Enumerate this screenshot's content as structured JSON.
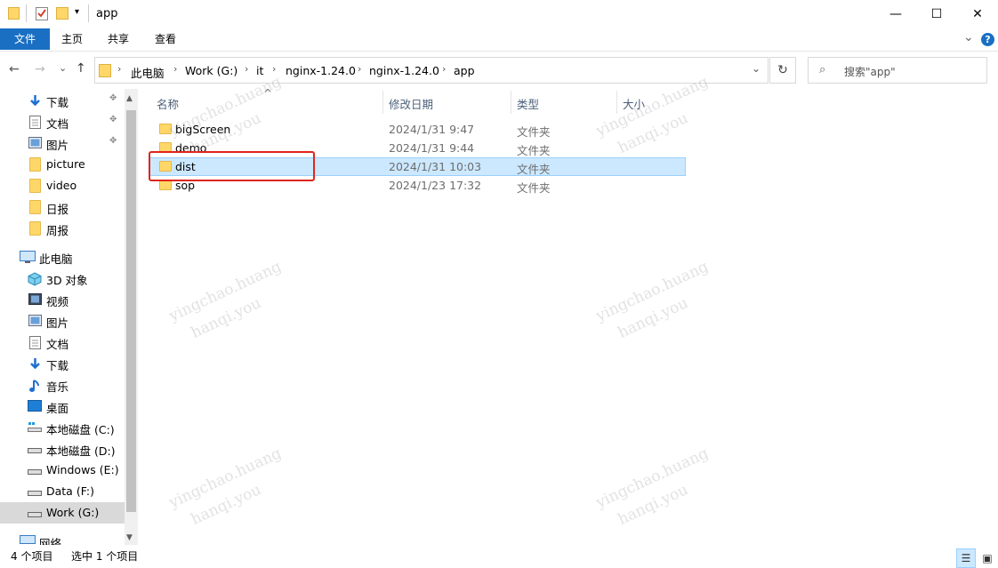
{
  "window": {
    "title": "app",
    "minimize": "—",
    "maximize": "☐",
    "close": "✕"
  },
  "ribbon": {
    "tabs": [
      "文件",
      "主页",
      "共享",
      "查看"
    ],
    "expand": "⌄",
    "help": "?"
  },
  "nav": {
    "back": "←",
    "forward": "→",
    "recent": "⌄",
    "up": "↑",
    "breadcrumbs": [
      "此电脑",
      "Work (G:)",
      "it",
      "nginx-1.24.0",
      "nginx-1.24.0",
      "app"
    ],
    "separator": "›",
    "dropdown": "⌄",
    "refresh": "↻",
    "search_placeholder": "搜索\"app\""
  },
  "sidebar": {
    "quick_access": [
      {
        "label": "下载",
        "icon": "download-icon",
        "pinned": true
      },
      {
        "label": "文档",
        "icon": "document-icon",
        "pinned": true
      },
      {
        "label": "图片",
        "icon": "picture-icon",
        "pinned": true
      },
      {
        "label": "picture",
        "icon": "folder-icon",
        "pinned": false
      },
      {
        "label": "video",
        "icon": "folder-icon",
        "pinned": false
      },
      {
        "label": "日报",
        "icon": "folder-icon",
        "pinned": false
      },
      {
        "label": "周报",
        "icon": "folder-icon",
        "pinned": false
      }
    ],
    "this_pc": {
      "label": "此电脑",
      "icon": "computer-icon"
    },
    "pc_items": [
      {
        "label": "3D 对象",
        "icon": "3d-objects-icon"
      },
      {
        "label": "视频",
        "icon": "video-icon"
      },
      {
        "label": "图片",
        "icon": "picture-icon"
      },
      {
        "label": "文档",
        "icon": "document-icon"
      },
      {
        "label": "下载",
        "icon": "download-icon"
      },
      {
        "label": "音乐",
        "icon": "music-icon"
      },
      {
        "label": "桌面",
        "icon": "desktop-icon"
      },
      {
        "label": "本地磁盘 (C:)",
        "icon": "drive-icon"
      },
      {
        "label": "本地磁盘 (D:)",
        "icon": "drive-icon"
      },
      {
        "label": "Windows (E:)",
        "icon": "drive-icon"
      },
      {
        "label": "Data (F:)",
        "icon": "drive-icon"
      },
      {
        "label": "Work (G:)",
        "icon": "drive-icon",
        "selected": true
      }
    ],
    "network": {
      "label": "网络",
      "icon": "network-icon"
    },
    "pin_glyph": "📌"
  },
  "columns": {
    "sort_indicator": "^",
    "name": "名称",
    "date": "修改日期",
    "type": "类型",
    "size": "大小"
  },
  "files": [
    {
      "name": "bigScreen",
      "date": "2024/1/31 9:47",
      "type": "文件夹",
      "selected": false
    },
    {
      "name": "demo",
      "date": "2024/1/31 9:44",
      "type": "文件夹",
      "selected": false
    },
    {
      "name": "dist",
      "date": "2024/1/31 10:03",
      "type": "文件夹",
      "selected": true
    },
    {
      "name": "sop",
      "date": "2024/1/23 17:32",
      "type": "文件夹",
      "selected": false
    }
  ],
  "watermark": {
    "line1": "yingchao.huang",
    "line2": "hanqi.you"
  },
  "status": {
    "item_count": "4 个项目",
    "selected": "选中 1 个项目"
  },
  "colors": {
    "accent": "#1a6fc3",
    "selection": "#cce8ff",
    "highlight": "#e0251b"
  }
}
